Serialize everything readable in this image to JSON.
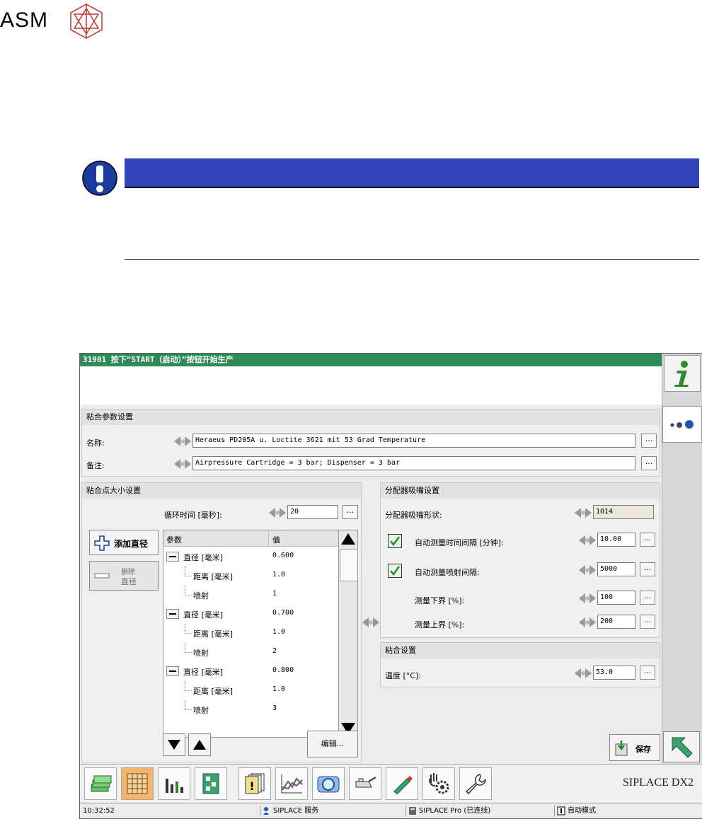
{
  "doc": {
    "logo_text": "ASM"
  },
  "window": {
    "title": "31901 按下“START（启动）”按钮开始生产",
    "adhesive_params": {
      "title": "粘合参数设置",
      "name_label": "名称:",
      "name_value": "Heraeus PD205A u. Loctite 3621 mit 53 Grad Temperature",
      "note_label": "备注:",
      "note_value": "Airpressure Cartridge = 3 bar; Dispenser = 3 bar"
    },
    "dot_size": {
      "title": "粘合点大小设置",
      "cycle_label": "循环时间 [毫秒]:",
      "cycle_value": "20",
      "add_button": "添加直径",
      "delete_button_line1": "删除",
      "delete_button_line2": "直径",
      "col_param": "参数",
      "col_value": "值",
      "rows": [
        {
          "name": "直径 [毫米]",
          "value": "0.600",
          "level": 0
        },
        {
          "name": "距离 [毫米]",
          "value": "1.0",
          "level": 1
        },
        {
          "name": "喷射",
          "value": "1",
          "level": 1
        },
        {
          "name": "直径 [毫米]",
          "value": "0.700",
          "level": 0
        },
        {
          "name": "距离 [毫米]",
          "value": "1.0",
          "level": 1
        },
        {
          "name": "喷射",
          "value": "2",
          "level": 1
        },
        {
          "name": "直径 [毫米]",
          "value": "0.800",
          "level": 0
        },
        {
          "name": "距离 [毫米]",
          "value": "1.0",
          "level": 1
        },
        {
          "name": "喷射",
          "value": "3",
          "level": 1
        }
      ],
      "edit_button": "编辑..."
    },
    "nozzle": {
      "title": "分配器吸嘴设置",
      "shape_label": "分配器吸嘴形状:",
      "shape_value": "1014",
      "auto_interval_label": "自动测量时间间隔 [分钟]:",
      "auto_interval_value": "10.00",
      "auto_interval_checked": true,
      "auto_shots_label": "自动测量喷射间隔:",
      "auto_shots_value": "5000",
      "auto_shots_checked": true,
      "lower_label": "测量下界 [%]:",
      "lower_value": "100",
      "upper_label": "测量上界 [%]:",
      "upper_value": "200"
    },
    "bonding": {
      "title": "粘合设置",
      "temp_label": "温度 [°C]:",
      "temp_value": "53.0"
    },
    "dots_label": "...",
    "save_button": "保存",
    "brand": "SIPLACE DX2",
    "status": {
      "time": "10:32:52",
      "service": "SIPLACE 服务",
      "pro": "SIPLACE Pro (已连线)",
      "mode": "自动模式"
    }
  },
  "colors": {
    "title_bar": "#2e8b57",
    "notice_bar": "#3344bb",
    "notice_icon": "#1a3a9c",
    "check_green": "#2a8a2a",
    "active_tab": "#f5b46a"
  }
}
